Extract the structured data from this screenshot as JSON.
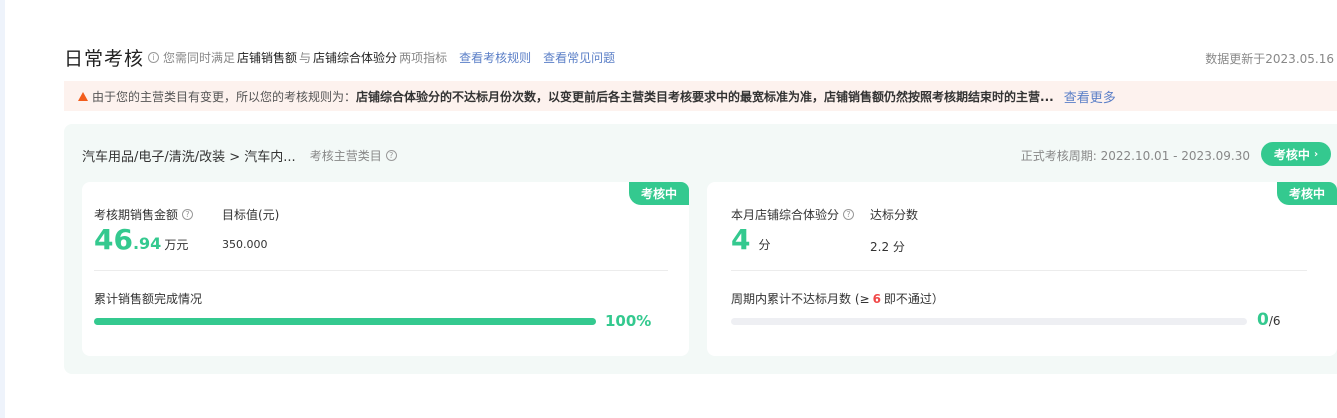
{
  "header": {
    "title": "日常考核",
    "info_icon": "info-circle-icon",
    "meta_prefix": "您需同时满足",
    "metric_a": "店铺销售额",
    "connector": "与",
    "metric_b": "店铺综合体验分",
    "meta_suffix": "两项指标",
    "link_rules": "查看考核规则",
    "link_faq": "查看常见问题",
    "update_time": "数据更新于2023.05.16"
  },
  "warning": {
    "icon": "warning-triangle-icon",
    "prefix": "由于您的主营类目有变更，所以您的考核规则为：",
    "bold_text": "店铺综合体验分的不达标月份次数，以变更前后各主营类目考核要求中的最宽标准为准，店铺销售额仍然按照考核期结束时的主营...",
    "more_link": "查看更多"
  },
  "panel": {
    "category_path": "汽车用品/电子/清洗/改装 > 汽车内...",
    "category_label": "考核主营类目",
    "period": "正式考核周期: 2022.10.01 - 2023.09.30",
    "status": "考核中",
    "status_chevron": "›"
  },
  "sales_card": {
    "tag": "考核中",
    "label": "考核期销售金额",
    "value_int": "46",
    "value_dec": ".94",
    "unit": "万元",
    "target_label": "目标值(元)",
    "target_value": "350.000",
    "progress_label": "累计销售额完成情况",
    "progress": 1.0,
    "progress_text": "100%"
  },
  "score_card": {
    "tag": "考核中",
    "label": "本月店铺综合体验分",
    "value": "4",
    "unit": "分",
    "threshold_label": "达标分数",
    "threshold_value": "2.2 分",
    "fail_label_prefix": "周期内累计不达标月数 (≥",
    "fail_limit": "6",
    "fail_label_suffix": "即不通过）",
    "fail_count": "0",
    "fail_total": "/6",
    "progress": 0.0
  },
  "colors": {
    "accent": "#34c98f",
    "link": "#5b7fc7",
    "warning": "#f25d1c",
    "danger": "#f04848"
  }
}
